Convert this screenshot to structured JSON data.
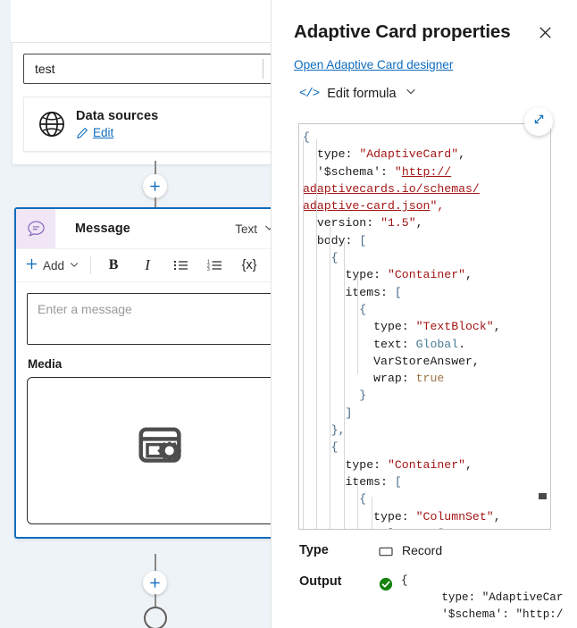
{
  "canvas": {
    "trigger": {
      "input_value": "test",
      "data_sources_label": "Data sources",
      "edit_link": "Edit",
      "globe_icon": "globe-icon",
      "pencil_icon": "pencil-icon"
    },
    "message_node": {
      "icon": "message-bubble-icon",
      "title": "Message",
      "type_selector": "Text",
      "chevron_icon": "chevron-down-icon",
      "toolbar": {
        "add_label": "Add",
        "plus_icon": "plus-icon",
        "add_chevron_icon": "chevron-down-icon",
        "bold_label": "B",
        "italic_label": "I",
        "bulleted_list_icon": "bulleted-list-icon",
        "numbered_list_icon": "numbered-list-icon",
        "variable_label": "{x}"
      },
      "message_placeholder": "Enter a message",
      "media_label": "Media",
      "media_placeholder_icon": "media-settings-icon"
    },
    "add_node_icon": "plus-icon",
    "end_node_icon": "end-circle-icon"
  },
  "panel": {
    "title": "Adaptive Card properties",
    "close_icon": "close-icon",
    "designer_link": "Open Adaptive Card designer",
    "formula_label": "Edit formula",
    "formula_code_icon": "code-icon",
    "formula_chevron_icon": "chevron-down-icon",
    "expand_icon": "expand-diagonal-icon",
    "code": {
      "lines": [
        [
          {
            "t": "{",
            "c": "tok-brk"
          }
        ],
        [
          {
            "t": "  type: ",
            "c": ""
          },
          {
            "t": "\"AdaptiveCard\"",
            "c": "tok-str"
          },
          {
            "t": ",",
            "c": ""
          }
        ],
        [
          {
            "t": "  '$schema': ",
            "c": ""
          },
          {
            "t": "\"",
            "c": "tok-str"
          },
          {
            "t": "http://",
            "c": "tok-link"
          }
        ],
        [
          {
            "t": "adaptivecards.io/schemas/",
            "c": "tok-link"
          }
        ],
        [
          {
            "t": "adaptive-card.json",
            "c": "tok-link"
          },
          {
            "t": "\",",
            "c": "tok-str"
          }
        ],
        [
          {
            "t": "  version: ",
            "c": ""
          },
          {
            "t": "\"1.5\"",
            "c": "tok-str"
          },
          {
            "t": ",",
            "c": ""
          }
        ],
        [
          {
            "t": "  body: ",
            "c": ""
          },
          {
            "t": "[",
            "c": "tok-brk"
          }
        ],
        [
          {
            "t": "    {",
            "c": "tok-brk"
          }
        ],
        [
          {
            "t": "      type: ",
            "c": ""
          },
          {
            "t": "\"Container\"",
            "c": "tok-str"
          },
          {
            "t": ",",
            "c": ""
          }
        ],
        [
          {
            "t": "      items: ",
            "c": ""
          },
          {
            "t": "[",
            "c": "tok-brk"
          }
        ],
        [
          {
            "t": "        {",
            "c": "tok-brk"
          }
        ],
        [
          {
            "t": "          type: ",
            "c": ""
          },
          {
            "t": "\"TextBlock\"",
            "c": "tok-str"
          },
          {
            "t": ",",
            "c": ""
          }
        ],
        [
          {
            "t": "          text: ",
            "c": ""
          },
          {
            "t": "Global",
            "c": "tok-global"
          },
          {
            "t": ".",
            "c": ""
          }
        ],
        [
          {
            "t": "          VarStoreAnswer,",
            "c": ""
          }
        ],
        [
          {
            "t": "          wrap: ",
            "c": ""
          },
          {
            "t": "true",
            "c": "tok-bool"
          }
        ],
        [
          {
            "t": "        }",
            "c": "tok-brk"
          }
        ],
        [
          {
            "t": "      ]",
            "c": "tok-brk"
          }
        ],
        [
          {
            "t": "    },",
            "c": "tok-brk"
          }
        ],
        [
          {
            "t": "    {",
            "c": "tok-brk"
          }
        ],
        [
          {
            "t": "      type: ",
            "c": ""
          },
          {
            "t": "\"Container\"",
            "c": "tok-str"
          },
          {
            "t": ",",
            "c": ""
          }
        ],
        [
          {
            "t": "      items: ",
            "c": ""
          },
          {
            "t": "[",
            "c": "tok-brk"
          }
        ],
        [
          {
            "t": "        {",
            "c": "tok-brk"
          }
        ],
        [
          {
            "t": "          type: ",
            "c": ""
          },
          {
            "t": "\"ColumnSet\"",
            "c": "tok-str"
          },
          {
            "t": ",",
            "c": ""
          }
        ],
        [
          {
            "t": "          columns: ",
            "c": ""
          },
          {
            "t": "[",
            "c": "tok-brk"
          }
        ]
      ]
    },
    "type_field": {
      "label": "Type",
      "icon": "record-icon",
      "value": "Record"
    },
    "output_field": {
      "label": "Output",
      "status_icon": "success-check-icon",
      "value": "{\n      type: \"AdaptiveCar\n      '$schema': \"http:/"
    }
  },
  "colors": {
    "accent_blue": "#0f6cbd",
    "node_border": "#0f6cbd",
    "string_red": "#a31515",
    "success_green": "#107c10",
    "panel_bg": "#ffffff",
    "canvas_bg": "#eef3f8",
    "message_icon_bg": "#f0e6f5",
    "message_icon_color": "#8764b8"
  }
}
